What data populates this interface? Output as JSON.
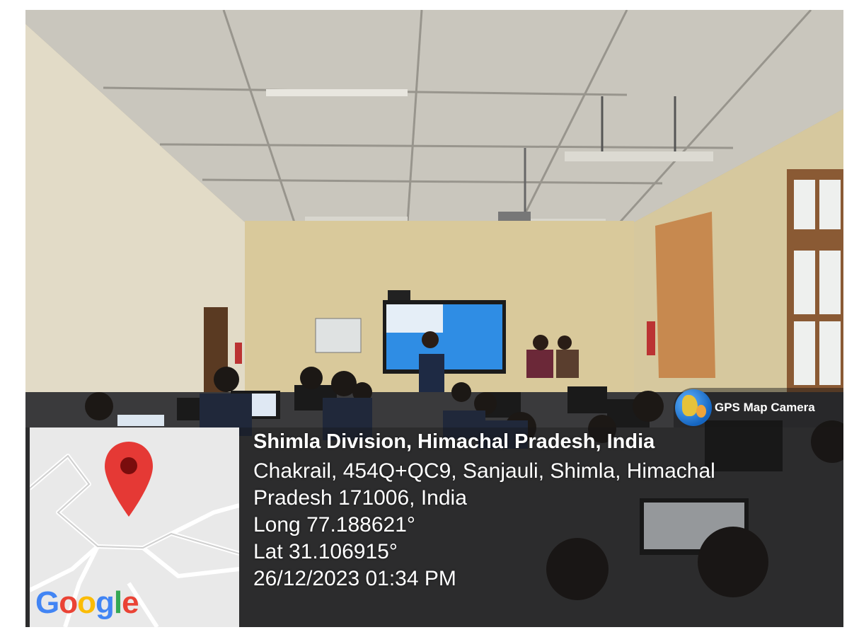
{
  "badge": {
    "label": "GPS Map Camera",
    "icon": "globe-icon"
  },
  "location": {
    "title": "Shimla Division, Himachal Pradesh, India",
    "address_line1": "Chakrail, 454Q+QC9, Sanjauli, Shimla, Himachal",
    "address_line2": "Pradesh 171006, India",
    "longitude": "Long 77.188621°",
    "latitude": "Lat 31.106915°",
    "datetime": "26/12/2023 01:34 PM"
  },
  "map": {
    "logo_text": "Google",
    "pin_icon": "map-pin-icon",
    "pin_color": "#e53935",
    "logo_colors": [
      "#4285F4",
      "#EA4335",
      "#FBBC05",
      "#4285F4",
      "#34A853",
      "#EA4335"
    ]
  }
}
